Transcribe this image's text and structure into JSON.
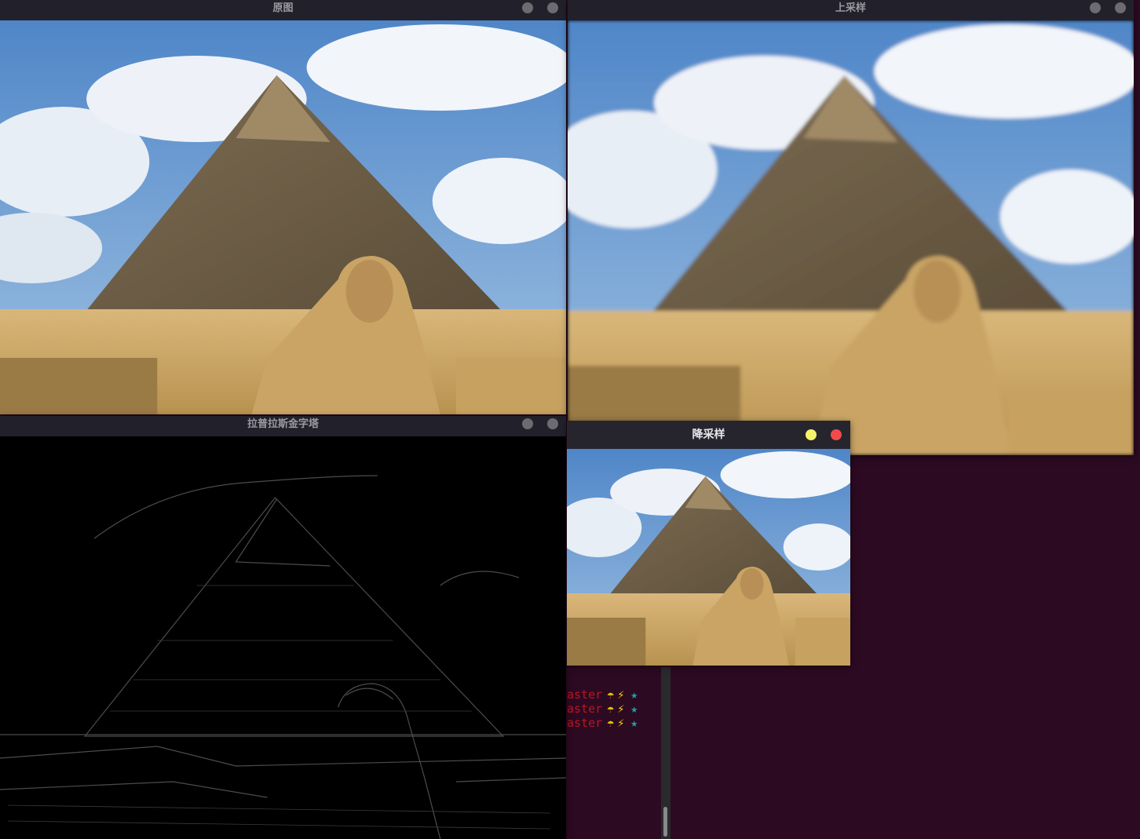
{
  "windows": {
    "original": {
      "title": "原图"
    },
    "upsample": {
      "title": "上采样"
    },
    "laplacian": {
      "title": "拉普拉斯金字塔"
    },
    "downsample": {
      "title": "降采样"
    }
  },
  "terminal": {
    "lines": [
      {
        "branch": "aster",
        "umbrella": "☂",
        "bolt": "⚡",
        "star": "★"
      },
      {
        "branch": "aster",
        "umbrella": "☂",
        "bolt": "⚡",
        "star": "★"
      },
      {
        "branch": "aster",
        "umbrella": "☂",
        "bolt": "⚡",
        "star": "★"
      }
    ]
  },
  "colors": {
    "desktop": "#2c0a22",
    "titlebar": "#22212b",
    "close_active": "#f24b4b",
    "minimize_active": "#f5f36a"
  },
  "icons": {
    "window_buttons": [
      "minimize-icon",
      "close-icon"
    ]
  }
}
